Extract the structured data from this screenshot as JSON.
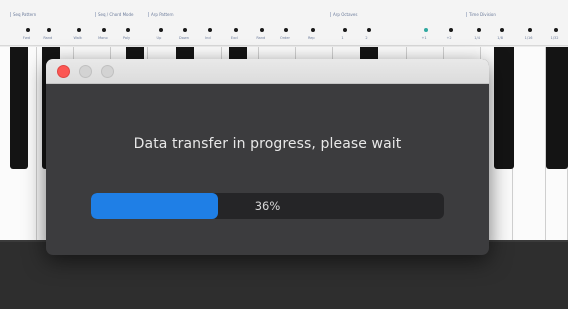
{
  "background_app": {
    "sections": [
      "Seq Pattern",
      "Seq / Chord Mode",
      "Arp Pattern",
      "Arp Octaves",
      "Time Division"
    ],
    "knob_labels": [
      "Fwd",
      "Rand",
      "Walk",
      "Mono",
      "Poly",
      "Up",
      "Down",
      "Incl",
      "Excl",
      "Rand",
      "Order",
      "Rep",
      "1",
      "2",
      "+1",
      "+2",
      "1/4",
      "1/8",
      "1/16",
      "1/32"
    ],
    "active_knob_index": 14
  },
  "dialog": {
    "message": "Data transfer in progress, please wait",
    "progress": {
      "percent": 36,
      "label": "36%",
      "fill_color": "#1f7fe6"
    },
    "buttons": {
      "close": "close",
      "minimize": "minimize",
      "zoom": "zoom"
    }
  }
}
